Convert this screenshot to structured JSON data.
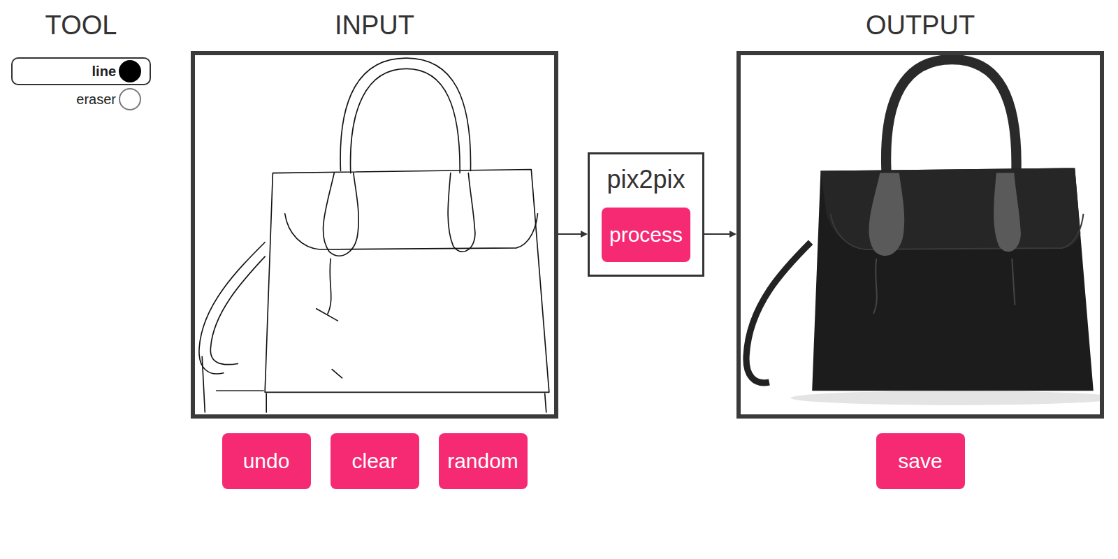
{
  "tools": {
    "title": "TOOL",
    "items": [
      {
        "label": "line",
        "selected": true
      },
      {
        "label": "eraser",
        "selected": false
      }
    ]
  },
  "input": {
    "title": "INPUT",
    "buttons": [
      "undo",
      "clear",
      "random"
    ]
  },
  "model": {
    "title": "pix2pix",
    "button": "process"
  },
  "output": {
    "title": "OUTPUT",
    "buttons": [
      "save"
    ]
  }
}
